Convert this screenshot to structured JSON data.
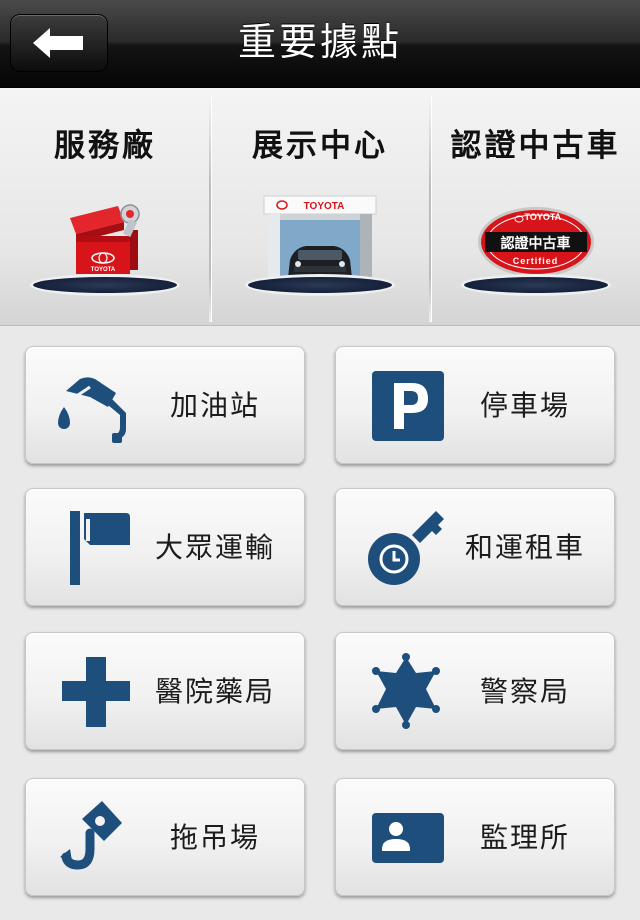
{
  "header": {
    "title": "重要據點",
    "back_icon": "arrow-left-icon"
  },
  "categories": [
    {
      "label": "服務廠",
      "icon": "toolbox-icon"
    },
    {
      "label": "展示中心",
      "icon": "showroom-car-icon"
    },
    {
      "label": "認證中古車",
      "icon": "certified-badge-icon",
      "badge": {
        "brand": "TOYOTA",
        "text": "認證中古車",
        "sub": "Certified"
      }
    }
  ],
  "showroom_sign": "TOYOTA",
  "toolbox_brand": "TOYOTA",
  "buttons": [
    {
      "label": "加油站",
      "icon": "fuel-nozzle-icon"
    },
    {
      "label": "停車場",
      "icon": "parking-icon"
    },
    {
      "label": "大眾運輸",
      "icon": "flag-icon"
    },
    {
      "label": "和運租車",
      "icon": "car-key-icon"
    },
    {
      "label": "醫院藥局",
      "icon": "medical-cross-icon"
    },
    {
      "label": "警察局",
      "icon": "police-star-icon"
    },
    {
      "label": "拖吊場",
      "icon": "tow-hook-icon"
    },
    {
      "label": "監理所",
      "icon": "id-card-icon"
    }
  ],
  "colors": {
    "icon_blue": "#1d4e7c",
    "toolbox_red": "#d7141a"
  }
}
